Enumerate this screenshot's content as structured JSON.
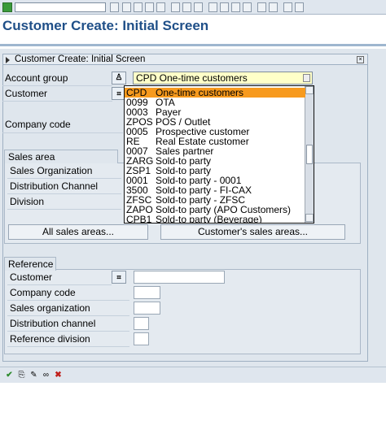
{
  "screen": {
    "title": "Customer Create: Initial Screen",
    "frame_title": "Customer Create: Initial Screen"
  },
  "fields": {
    "account_group_label": "Account group",
    "account_group_value": "CPD One-time customers",
    "customer_label": "Customer",
    "company_code_label": "Company code"
  },
  "sales_area": {
    "tab": "Sales area",
    "sales_org_label": "Sales Organization",
    "distribution_channel_label": "Distribution Channel",
    "division_label": "Division",
    "all_sales_areas_button": "All sales areas...",
    "customers_sales_areas_button": "Customer's sales areas..."
  },
  "reference": {
    "tab": "Reference",
    "customer_label": "Customer",
    "company_code_label": "Company code",
    "sales_org_label": "Sales organization",
    "distribution_channel_label": "Distribution channel",
    "division_label": "Reference division"
  },
  "dropdown_items": [
    {
      "key": "CPD",
      "desc": "One-time customers",
      "selected": true
    },
    {
      "key": "0099",
      "desc": "OTA"
    },
    {
      "key": "0003",
      "desc": "Payer"
    },
    {
      "key": "ZPOS",
      "desc": "POS / Outlet"
    },
    {
      "key": "0005",
      "desc": "Prospective customer"
    },
    {
      "key": "RE",
      "desc": "Real Estate customer"
    },
    {
      "key": "0007",
      "desc": "Sales partner"
    },
    {
      "key": "ZARG",
      "desc": "Sold-to party"
    },
    {
      "key": "ZSP1",
      "desc": "Sold-to party"
    },
    {
      "key": "0001",
      "desc": "Sold-to party - 0001"
    },
    {
      "key": "3500",
      "desc": "Sold-to party - FI-CAX"
    },
    {
      "key": "ZFSC",
      "desc": "Sold-to party - ZFSC"
    },
    {
      "key": "ZAPO",
      "desc": "Sold-to party (APO Customers)"
    },
    {
      "key": "CPB1",
      "desc": "Sold-to party (Beverage)"
    }
  ],
  "colors": {
    "title": "#1f4f88",
    "selection": "#f79a1e",
    "input_highlight": "#ffffc8"
  }
}
